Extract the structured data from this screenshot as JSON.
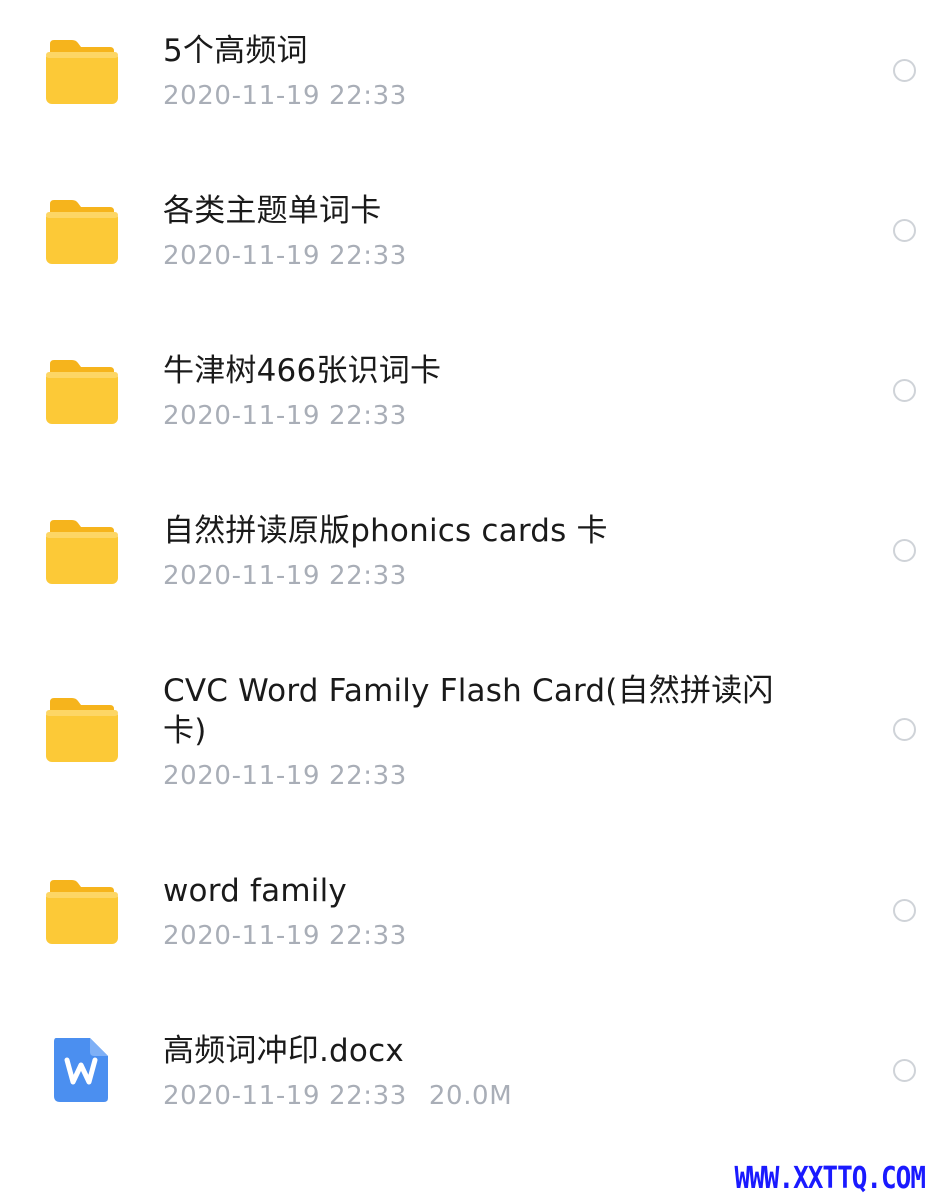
{
  "files": [
    {
      "type": "folder",
      "icon": "folder-icon",
      "name": "5个高频词",
      "date": "2020-11-19 22:33",
      "size": ""
    },
    {
      "type": "folder",
      "icon": "folder-icon",
      "name": "各类主题单词卡",
      "date": "2020-11-19 22:33",
      "size": ""
    },
    {
      "type": "folder",
      "icon": "folder-icon",
      "name": "牛津树466张识词卡",
      "date": "2020-11-19 22:33",
      "size": ""
    },
    {
      "type": "folder",
      "icon": "folder-icon",
      "name": "自然拼读原版phonics cards 卡",
      "date": "2020-11-19 22:33",
      "size": ""
    },
    {
      "type": "folder",
      "icon": "folder-icon",
      "name": "CVC Word Family Flash Card(自然拼读闪卡)",
      "date": "2020-11-19 22:33",
      "size": ""
    },
    {
      "type": "folder",
      "icon": "folder-icon",
      "name": "word family",
      "date": "2020-11-19 22:33",
      "size": ""
    },
    {
      "type": "file",
      "icon": "word-document-icon",
      "name": "高频词冲印.docx",
      "date": "2020-11-19 22:33",
      "size": "20.0M"
    }
  ],
  "watermark": "WWW.XXTTQ.COM",
  "colors": {
    "folder": "#fcc937",
    "word_doc": "#4b8ff0",
    "meta_text": "#a9aeb7",
    "radio_border": "#cfd3d8",
    "watermark": "#1a1aff"
  }
}
